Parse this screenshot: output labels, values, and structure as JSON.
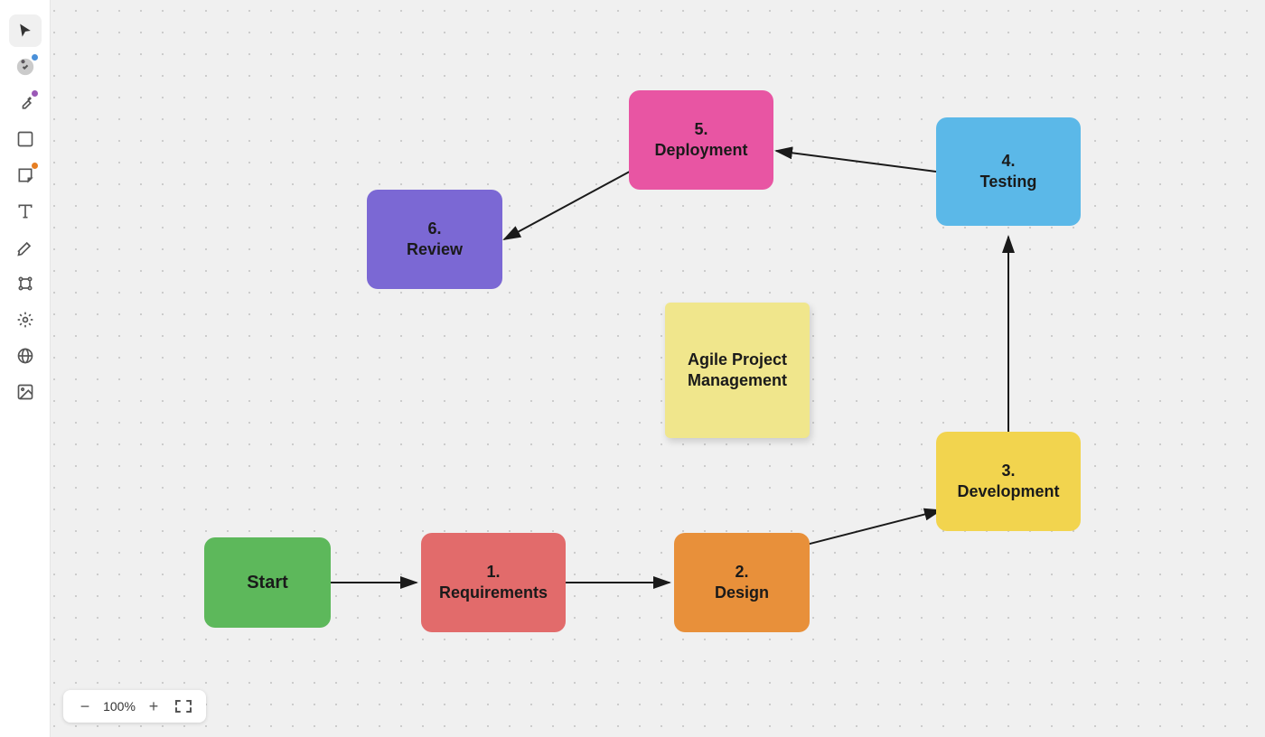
{
  "sidebar": {
    "items": [
      {
        "name": "select-tool",
        "label": "Select",
        "active": true,
        "icon": "cursor"
      },
      {
        "name": "magic-tool",
        "label": "Magic",
        "active": false,
        "icon": "magic",
        "dot": "blue"
      },
      {
        "name": "pen-tool",
        "label": "Pen",
        "active": false,
        "icon": "pen",
        "dot": "purple"
      },
      {
        "name": "shape-tool",
        "label": "Shape",
        "active": false,
        "icon": "shape",
        "dot": ""
      },
      {
        "name": "sticky-tool",
        "label": "Sticky Note",
        "active": false,
        "icon": "sticky",
        "dot": "orange"
      },
      {
        "name": "text-tool",
        "label": "Text",
        "active": false,
        "icon": "text"
      },
      {
        "name": "edit-tool",
        "label": "Edit",
        "active": false,
        "icon": "edit"
      },
      {
        "name": "connect-tool",
        "label": "Connect",
        "active": false,
        "icon": "connect"
      },
      {
        "name": "smart-tool",
        "label": "Smart",
        "active": false,
        "icon": "smart"
      },
      {
        "name": "globe-tool",
        "label": "Globe",
        "active": false,
        "icon": "globe"
      },
      {
        "name": "image-tool",
        "label": "Image",
        "active": false,
        "icon": "image"
      }
    ]
  },
  "nodes": {
    "start": {
      "label": "Start",
      "color": "#5DB85B"
    },
    "requirements": {
      "label": "1.\nRequirements",
      "line1": "1.",
      "line2": "Requirements",
      "color": "#E26B6B"
    },
    "design": {
      "label": "2.\nDesign",
      "line1": "2.",
      "line2": "Design",
      "color": "#E8903A"
    },
    "development": {
      "label": "3.\nDevelopment",
      "line1": "3.",
      "line2": "Development",
      "color": "#F2D44E"
    },
    "testing": {
      "label": "4.\nTesting",
      "line1": "4.",
      "line2": "Testing",
      "color": "#5BB8E8"
    },
    "deployment": {
      "label": "5.\nDeployment",
      "line1": "5.",
      "line2": "Deployment",
      "color": "#E855A3"
    },
    "review": {
      "label": "6.\nReview",
      "line1": "6.",
      "line2": "Review",
      "color": "#7B68D4"
    },
    "agile": {
      "label": "Agile Project\nManagement",
      "line1": "Agile Project",
      "line2": "Management",
      "color": "#F0E68C"
    }
  },
  "zoom": {
    "level": "100%",
    "minus_label": "−",
    "plus_label": "+",
    "fit_label": "↔"
  }
}
